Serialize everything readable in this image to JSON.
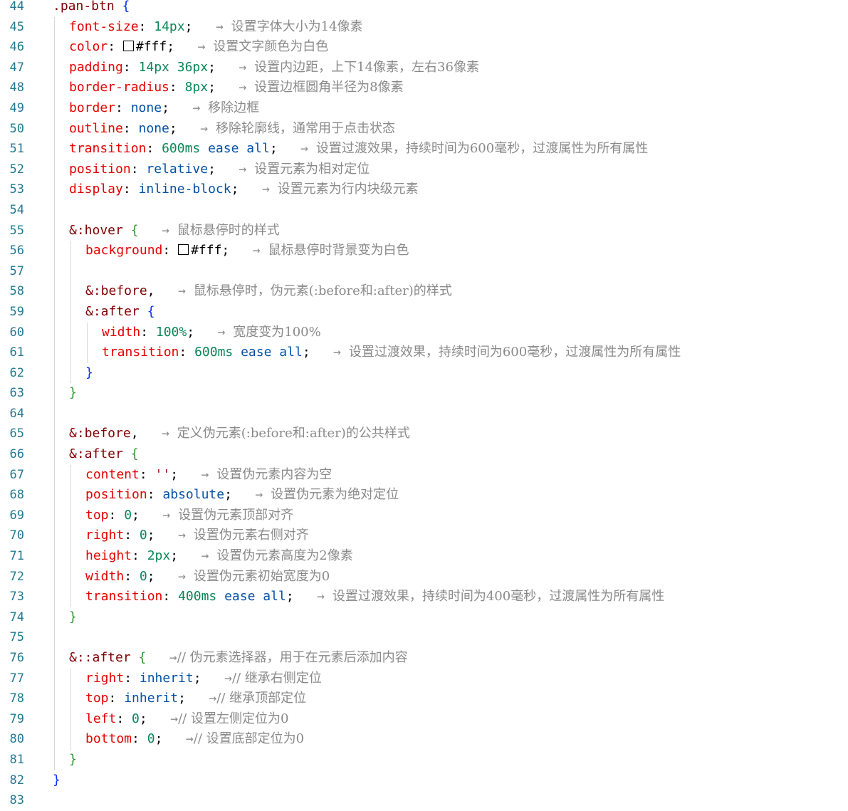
{
  "editor": {
    "lines": [
      {
        "n": "44",
        "indent": 0,
        "guides": 0,
        "tokens": [
          [
            "sel",
            ".pan-btn"
          ],
          [
            "plain",
            " "
          ],
          [
            "brace-o",
            "{"
          ]
        ]
      },
      {
        "n": "45",
        "indent": 1,
        "guides": 1,
        "tokens": [
          [
            "prop",
            "font-size"
          ],
          [
            "plain",
            ": "
          ],
          [
            "num",
            "14px"
          ],
          [
            "plain",
            ";"
          ],
          [
            "plain",
            "   "
          ],
          [
            "arrow",
            "→ "
          ],
          [
            "comment",
            "设置字体大小为14像素"
          ]
        ]
      },
      {
        "n": "46",
        "indent": 1,
        "guides": 1,
        "tokens": [
          [
            "prop",
            "color"
          ],
          [
            "plain",
            ": "
          ],
          [
            "swatch",
            ""
          ],
          [
            "plain",
            "#fff"
          ],
          [
            "plain",
            ";"
          ],
          [
            "plain",
            "   "
          ],
          [
            "arrow",
            "→ "
          ],
          [
            "comment",
            "设置文字颜色为白色"
          ]
        ]
      },
      {
        "n": "47",
        "indent": 1,
        "guides": 1,
        "tokens": [
          [
            "prop",
            "padding"
          ],
          [
            "plain",
            ": "
          ],
          [
            "num",
            "14px"
          ],
          [
            "plain",
            " "
          ],
          [
            "num",
            "36px"
          ],
          [
            "plain",
            ";"
          ],
          [
            "plain",
            "   "
          ],
          [
            "arrow",
            "→ "
          ],
          [
            "comment",
            "设置内边距，上下14像素，左右36像素"
          ]
        ]
      },
      {
        "n": "48",
        "indent": 1,
        "guides": 1,
        "tokens": [
          [
            "prop",
            "border-radius"
          ],
          [
            "plain",
            ": "
          ],
          [
            "num",
            "8px"
          ],
          [
            "plain",
            ";"
          ],
          [
            "plain",
            "   "
          ],
          [
            "arrow",
            "→ "
          ],
          [
            "comment",
            "设置边框圆角半径为8像素"
          ]
        ]
      },
      {
        "n": "49",
        "indent": 1,
        "guides": 1,
        "tokens": [
          [
            "prop",
            "border"
          ],
          [
            "plain",
            ": "
          ],
          [
            "val",
            "none"
          ],
          [
            "plain",
            ";"
          ],
          [
            "plain",
            "   "
          ],
          [
            "arrow",
            "→ "
          ],
          [
            "comment",
            "移除边框"
          ]
        ]
      },
      {
        "n": "50",
        "indent": 1,
        "guides": 1,
        "tokens": [
          [
            "prop",
            "outline"
          ],
          [
            "plain",
            ": "
          ],
          [
            "val",
            "none"
          ],
          [
            "plain",
            ";"
          ],
          [
            "plain",
            "   "
          ],
          [
            "arrow",
            "→ "
          ],
          [
            "comment",
            "移除轮廓线，通常用于点击状态"
          ]
        ]
      },
      {
        "n": "51",
        "indent": 1,
        "guides": 1,
        "tokens": [
          [
            "prop",
            "transition"
          ],
          [
            "plain",
            ": "
          ],
          [
            "num",
            "600ms"
          ],
          [
            "plain",
            " "
          ],
          [
            "val",
            "ease"
          ],
          [
            "plain",
            " "
          ],
          [
            "val",
            "all"
          ],
          [
            "plain",
            ";"
          ],
          [
            "plain",
            "   "
          ],
          [
            "arrow",
            "→ "
          ],
          [
            "comment",
            "设置过渡效果，持续时间为600毫秒，过渡属性为所有属性"
          ]
        ]
      },
      {
        "n": "52",
        "indent": 1,
        "guides": 1,
        "tokens": [
          [
            "prop",
            "position"
          ],
          [
            "plain",
            ": "
          ],
          [
            "val",
            "relative"
          ],
          [
            "plain",
            ";"
          ],
          [
            "plain",
            "   "
          ],
          [
            "arrow",
            "→ "
          ],
          [
            "comment",
            "设置元素为相对定位"
          ]
        ]
      },
      {
        "n": "53",
        "indent": 1,
        "guides": 1,
        "tokens": [
          [
            "prop",
            "display"
          ],
          [
            "plain",
            ": "
          ],
          [
            "val",
            "inline-block"
          ],
          [
            "plain",
            ";"
          ],
          [
            "plain",
            "   "
          ],
          [
            "arrow",
            "→ "
          ],
          [
            "comment",
            "设置元素为行内块级元素"
          ]
        ]
      },
      {
        "n": "54",
        "indent": 1,
        "guides": 1,
        "tokens": []
      },
      {
        "n": "55",
        "indent": 1,
        "guides": 1,
        "tokens": [
          [
            "sel",
            "&:hover"
          ],
          [
            "plain",
            " "
          ],
          [
            "brace",
            "{"
          ],
          [
            "plain",
            "   "
          ],
          [
            "arrow",
            "→ "
          ],
          [
            "comment",
            "鼠标悬停时的样式"
          ]
        ]
      },
      {
        "n": "56",
        "indent": 2,
        "guides": 2,
        "tokens": [
          [
            "prop",
            "background"
          ],
          [
            "plain",
            ": "
          ],
          [
            "swatch",
            ""
          ],
          [
            "plain",
            "#fff"
          ],
          [
            "plain",
            ";"
          ],
          [
            "plain",
            "   "
          ],
          [
            "arrow",
            "→ "
          ],
          [
            "comment",
            "鼠标悬停时背景变为白色"
          ]
        ]
      },
      {
        "n": "57",
        "indent": 2,
        "guides": 2,
        "tokens": []
      },
      {
        "n": "58",
        "indent": 2,
        "guides": 2,
        "tokens": [
          [
            "sel",
            "&:before"
          ],
          [
            "plain",
            ","
          ],
          [
            "plain",
            "   "
          ],
          [
            "arrow",
            "→ "
          ],
          [
            "comment",
            "鼠标悬停时，伪元素(:before和:after)的样式"
          ]
        ]
      },
      {
        "n": "59",
        "indent": 2,
        "guides": 2,
        "tokens": [
          [
            "sel",
            "&:after"
          ],
          [
            "plain",
            " "
          ],
          [
            "brace-o",
            "{"
          ]
        ]
      },
      {
        "n": "60",
        "indent": 3,
        "guides": 3,
        "tokens": [
          [
            "prop",
            "width"
          ],
          [
            "plain",
            ": "
          ],
          [
            "num",
            "100%"
          ],
          [
            "plain",
            ";"
          ],
          [
            "plain",
            "   "
          ],
          [
            "arrow",
            "→ "
          ],
          [
            "comment",
            "宽度变为100%"
          ]
        ]
      },
      {
        "n": "61",
        "indent": 3,
        "guides": 3,
        "tokens": [
          [
            "prop",
            "transition"
          ],
          [
            "plain",
            ": "
          ],
          [
            "num",
            "600ms"
          ],
          [
            "plain",
            " "
          ],
          [
            "val",
            "ease"
          ],
          [
            "plain",
            " "
          ],
          [
            "val",
            "all"
          ],
          [
            "plain",
            ";"
          ],
          [
            "plain",
            "   "
          ],
          [
            "arrow",
            "→ "
          ],
          [
            "comment",
            "设置过渡效果，持续时间为600毫秒，过渡属性为所有属性"
          ]
        ]
      },
      {
        "n": "62",
        "indent": 2,
        "guides": 2,
        "tokens": [
          [
            "brace-o",
            "}"
          ]
        ]
      },
      {
        "n": "63",
        "indent": 1,
        "guides": 1,
        "tokens": [
          [
            "brace",
            "}"
          ]
        ]
      },
      {
        "n": "64",
        "indent": 1,
        "guides": 1,
        "tokens": []
      },
      {
        "n": "65",
        "indent": 1,
        "guides": 1,
        "tokens": [
          [
            "sel",
            "&:before"
          ],
          [
            "plain",
            ","
          ],
          [
            "plain",
            "   "
          ],
          [
            "arrow",
            "→ "
          ],
          [
            "comment",
            "定义伪元素(:before和:after)的公共样式"
          ]
        ]
      },
      {
        "n": "66",
        "indent": 1,
        "guides": 1,
        "tokens": [
          [
            "sel",
            "&:after"
          ],
          [
            "plain",
            " "
          ],
          [
            "brace",
            "{"
          ]
        ]
      },
      {
        "n": "67",
        "indent": 2,
        "guides": 2,
        "tokens": [
          [
            "prop",
            "content"
          ],
          [
            "plain",
            ": "
          ],
          [
            "str",
            "''"
          ],
          [
            "plain",
            ";"
          ],
          [
            "plain",
            "   "
          ],
          [
            "arrow",
            "→ "
          ],
          [
            "comment",
            "设置伪元素内容为空"
          ]
        ]
      },
      {
        "n": "68",
        "indent": 2,
        "guides": 2,
        "tokens": [
          [
            "prop",
            "position"
          ],
          [
            "plain",
            ": "
          ],
          [
            "val",
            "absolute"
          ],
          [
            "plain",
            ";"
          ],
          [
            "plain",
            "   "
          ],
          [
            "arrow",
            "→ "
          ],
          [
            "comment",
            "设置伪元素为绝对定位"
          ]
        ]
      },
      {
        "n": "69",
        "indent": 2,
        "guides": 2,
        "tokens": [
          [
            "prop",
            "top"
          ],
          [
            "plain",
            ": "
          ],
          [
            "num",
            "0"
          ],
          [
            "plain",
            ";"
          ],
          [
            "plain",
            "   "
          ],
          [
            "arrow",
            "→ "
          ],
          [
            "comment",
            "设置伪元素顶部对齐"
          ]
        ]
      },
      {
        "n": "70",
        "indent": 2,
        "guides": 2,
        "tokens": [
          [
            "prop",
            "right"
          ],
          [
            "plain",
            ": "
          ],
          [
            "num",
            "0"
          ],
          [
            "plain",
            ";"
          ],
          [
            "plain",
            "   "
          ],
          [
            "arrow",
            "→ "
          ],
          [
            "comment",
            "设置伪元素右侧对齐"
          ]
        ]
      },
      {
        "n": "71",
        "indent": 2,
        "guides": 2,
        "tokens": [
          [
            "prop",
            "height"
          ],
          [
            "plain",
            ": "
          ],
          [
            "num",
            "2px"
          ],
          [
            "plain",
            ";"
          ],
          [
            "plain",
            "   "
          ],
          [
            "arrow",
            "→ "
          ],
          [
            "comment",
            "设置伪元素高度为2像素"
          ]
        ]
      },
      {
        "n": "72",
        "indent": 2,
        "guides": 2,
        "tokens": [
          [
            "prop",
            "width"
          ],
          [
            "plain",
            ": "
          ],
          [
            "num",
            "0"
          ],
          [
            "plain",
            ";"
          ],
          [
            "plain",
            "   "
          ],
          [
            "arrow",
            "→ "
          ],
          [
            "comment",
            "设置伪元素初始宽度为0"
          ]
        ]
      },
      {
        "n": "73",
        "indent": 2,
        "guides": 2,
        "tokens": [
          [
            "prop",
            "transition"
          ],
          [
            "plain",
            ": "
          ],
          [
            "num",
            "400ms"
          ],
          [
            "plain",
            " "
          ],
          [
            "val",
            "ease"
          ],
          [
            "plain",
            " "
          ],
          [
            "val",
            "all"
          ],
          [
            "plain",
            ";"
          ],
          [
            "plain",
            "   "
          ],
          [
            "arrow",
            "→ "
          ],
          [
            "comment",
            "设置过渡效果，持续时间为400毫秒，过渡属性为所有属性"
          ]
        ]
      },
      {
        "n": "74",
        "indent": 1,
        "guides": 1,
        "tokens": [
          [
            "brace",
            "}"
          ]
        ]
      },
      {
        "n": "75",
        "indent": 1,
        "guides": 1,
        "tokens": []
      },
      {
        "n": "76",
        "indent": 1,
        "guides": 1,
        "tokens": [
          [
            "sel",
            "&::after"
          ],
          [
            "plain",
            " "
          ],
          [
            "brace",
            "{"
          ],
          [
            "plain",
            "   "
          ],
          [
            "arrow",
            "→"
          ],
          [
            "comment",
            "// 伪元素选择器，用于在元素后添加内容"
          ]
        ]
      },
      {
        "n": "77",
        "indent": 2,
        "guides": 2,
        "tokens": [
          [
            "prop",
            "right"
          ],
          [
            "plain",
            ": "
          ],
          [
            "val",
            "inherit"
          ],
          [
            "plain",
            ";"
          ],
          [
            "plain",
            "   "
          ],
          [
            "arrow",
            "→"
          ],
          [
            "comment",
            "// 继承右侧定位"
          ]
        ]
      },
      {
        "n": "78",
        "indent": 2,
        "guides": 2,
        "tokens": [
          [
            "prop",
            "top"
          ],
          [
            "plain",
            ": "
          ],
          [
            "val",
            "inherit"
          ],
          [
            "plain",
            ";"
          ],
          [
            "plain",
            "   "
          ],
          [
            "arrow",
            "→"
          ],
          [
            "comment",
            "// 继承顶部定位"
          ]
        ]
      },
      {
        "n": "79",
        "indent": 2,
        "guides": 2,
        "tokens": [
          [
            "prop",
            "left"
          ],
          [
            "plain",
            ": "
          ],
          [
            "num",
            "0"
          ],
          [
            "plain",
            ";"
          ],
          [
            "plain",
            "   "
          ],
          [
            "arrow",
            "→"
          ],
          [
            "comment",
            "// 设置左侧定位为0"
          ]
        ]
      },
      {
        "n": "80",
        "indent": 2,
        "guides": 2,
        "tokens": [
          [
            "prop",
            "bottom"
          ],
          [
            "plain",
            ": "
          ],
          [
            "num",
            "0"
          ],
          [
            "plain",
            ";"
          ],
          [
            "plain",
            "   "
          ],
          [
            "arrow",
            "→"
          ],
          [
            "comment",
            "// 设置底部定位为0"
          ]
        ]
      },
      {
        "n": "81",
        "indent": 1,
        "guides": 1,
        "tokens": [
          [
            "brace",
            "}"
          ]
        ]
      },
      {
        "n": "82",
        "indent": 0,
        "guides": 0,
        "tokens": [
          [
            "brace-o",
            "}"
          ]
        ]
      },
      {
        "n": "83",
        "indent": 0,
        "guides": 0,
        "tokens": []
      }
    ]
  }
}
